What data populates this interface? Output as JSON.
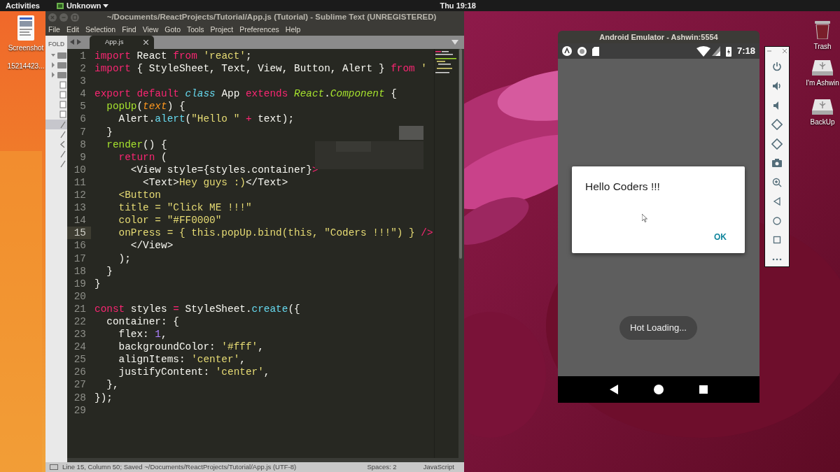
{
  "top_bar": {
    "activities": "Activities",
    "app_menu": "Unknown",
    "clock": "Thu 19:18"
  },
  "desktop_left": [
    {
      "kind": "document",
      "labels": [
        "Screenshot",
        "15214423..."
      ]
    }
  ],
  "desktop_right": [
    {
      "kind": "trash",
      "labels": [
        "Trash"
      ]
    },
    {
      "kind": "drive",
      "labels": [
        "I'm Ashwin"
      ]
    },
    {
      "kind": "drive",
      "labels": [
        "BackUp"
      ]
    }
  ],
  "editor": {
    "title": "~/Documents/ReactProjects/Tutorial/App.js (Tutorial) - Sublime Text (UNREGISTERED)",
    "menu": [
      "File",
      "Edit",
      "Selection",
      "Find",
      "View",
      "Goto",
      "Tools",
      "Project",
      "Preferences",
      "Help"
    ],
    "sidebar": {
      "header": "FOLD",
      "rows": [
        {
          "kind": "folder",
          "expanded": true,
          "selected": false
        },
        {
          "kind": "folder",
          "expanded": false,
          "selected": false
        },
        {
          "kind": "folder",
          "expanded": false,
          "selected": false
        },
        {
          "kind": "file",
          "selected": false
        },
        {
          "kind": "file",
          "selected": false
        },
        {
          "kind": "file",
          "selected": false
        },
        {
          "kind": "file",
          "selected": false
        },
        {
          "kind": "script",
          "selected": true
        },
        {
          "kind": "script",
          "selected": false
        },
        {
          "kind": "markup",
          "selected": false
        },
        {
          "kind": "script",
          "selected": false
        },
        {
          "kind": "script",
          "selected": false
        }
      ]
    },
    "tabs": [
      {
        "label": "App.js",
        "selected": true
      }
    ],
    "lines": [
      {
        "number": "1",
        "highlighted": false,
        "tokens": [
          {
            "kind": "k",
            "text": "import"
          },
          {
            "kind": "t",
            "text": " React"
          },
          {
            "kind": "k",
            "text": " from"
          },
          {
            "kind": "s",
            "text": " 'react'"
          },
          {
            "kind": "t",
            "text": ";"
          }
        ]
      },
      {
        "number": "2",
        "highlighted": false,
        "tokens": [
          {
            "kind": "k",
            "text": "import"
          },
          {
            "kind": "t",
            "text": " { StyleSheet, Text, View, Button, Alert }"
          },
          {
            "kind": "k",
            "text": " from"
          },
          {
            "kind": "s",
            "text": " '"
          }
        ]
      },
      {
        "number": "3",
        "highlighted": false
      },
      {
        "number": "4",
        "highlighted": false,
        "tokens": [
          {
            "kind": "k",
            "text": "export"
          },
          {
            "kind": "k",
            "text": " default"
          },
          {
            "kind": "i",
            "text": " class"
          },
          {
            "kind": "t",
            "text": " App"
          },
          {
            "kind": "k",
            "text": " extends"
          },
          {
            "kind": "c",
            "text": " React"
          },
          {
            "kind": "t",
            "text": "."
          },
          {
            "kind": "c",
            "text": "Component"
          },
          {
            "kind": "t",
            "text": " {"
          }
        ]
      },
      {
        "number": "5",
        "highlighted": false,
        "tokens": [
          {
            "kind": "g",
            "text": "  popUp"
          },
          {
            "kind": "t",
            "text": "("
          },
          {
            "kind": "p",
            "text": "text"
          },
          {
            "kind": "t",
            "text": ") {"
          }
        ]
      },
      {
        "number": "6",
        "highlighted": false,
        "tokens": [
          {
            "kind": "t",
            "text": "    Alert."
          },
          {
            "kind": "f",
            "text": "alert"
          },
          {
            "kind": "t",
            "text": "("
          },
          {
            "kind": "s",
            "text": "\"Hello \""
          },
          {
            "kind": "k",
            "text": " +"
          },
          {
            "kind": "t",
            "text": " text);"
          }
        ]
      },
      {
        "number": "7",
        "highlighted": false,
        "tokens": [
          {
            "kind": "t",
            "text": "  }"
          }
        ]
      },
      {
        "number": "8",
        "highlighted": false,
        "tokens": [
          {
            "kind": "g",
            "text": "  render"
          },
          {
            "kind": "t",
            "text": "() {"
          }
        ]
      },
      {
        "number": "9",
        "highlighted": false,
        "tokens": [
          {
            "kind": "k",
            "text": "    return"
          },
          {
            "kind": "t",
            "text": " ("
          }
        ]
      },
      {
        "number": "10",
        "highlighted": false,
        "tokens": [
          {
            "kind": "t",
            "text": "      <View style={styles.container}"
          },
          {
            "kind": "k",
            "text": ">"
          }
        ]
      },
      {
        "number": "11",
        "highlighted": false,
        "tokens": [
          {
            "kind": "t",
            "text": "        <Text>"
          },
          {
            "kind": "s",
            "text": "Hey guys :)"
          },
          {
            "kind": "t",
            "text": "</Text>"
          }
        ]
      },
      {
        "number": "12",
        "highlighted": false,
        "tokens": [
          {
            "kind": "s",
            "text": "    <Button"
          }
        ]
      },
      {
        "number": "13",
        "highlighted": false,
        "tokens": [
          {
            "kind": "s",
            "text": "    title = \"Click ME !!!\""
          }
        ]
      },
      {
        "number": "14",
        "highlighted": false,
        "tokens": [
          {
            "kind": "s",
            "text": "    color = \"#FF0000\""
          }
        ]
      },
      {
        "number": "15",
        "highlighted": true,
        "tokens": [
          {
            "kind": "s",
            "text": "    onPress = { this.popUp.bind(this, \"Coders !!!\") }"
          },
          {
            "kind": "k",
            "text": " />"
          }
        ]
      },
      {
        "number": "16",
        "highlighted": false,
        "tokens": [
          {
            "kind": "t",
            "text": "      </View>"
          }
        ]
      },
      {
        "number": "17",
        "highlighted": false,
        "tokens": [
          {
            "kind": "t",
            "text": "    );"
          }
        ]
      },
      {
        "number": "18",
        "highlighted": false,
        "tokens": [
          {
            "kind": "t",
            "text": "  }"
          }
        ]
      },
      {
        "number": "19",
        "highlighted": false,
        "tokens": [
          {
            "kind": "t",
            "text": "}"
          }
        ]
      },
      {
        "number": "20",
        "highlighted": false
      },
      {
        "number": "21",
        "highlighted": false,
        "tokens": [
          {
            "kind": "k",
            "text": "const"
          },
          {
            "kind": "t",
            "text": " styles"
          },
          {
            "kind": "k",
            "text": " ="
          },
          {
            "kind": "t",
            "text": " StyleSheet."
          },
          {
            "kind": "f",
            "text": "create"
          },
          {
            "kind": "t",
            "text": "({"
          }
        ]
      },
      {
        "number": "22",
        "highlighted": false,
        "tokens": [
          {
            "kind": "t",
            "text": "  container: {"
          }
        ]
      },
      {
        "number": "23",
        "highlighted": false,
        "tokens": [
          {
            "kind": "t",
            "text": "    flex:"
          },
          {
            "kind": "n",
            "text": " 1"
          },
          {
            "kind": "t",
            "text": ","
          }
        ]
      },
      {
        "number": "24",
        "highlighted": false,
        "tokens": [
          {
            "kind": "t",
            "text": "    backgroundColor:"
          },
          {
            "kind": "s",
            "text": " '#fff'"
          },
          {
            "kind": "t",
            "text": ","
          }
        ]
      },
      {
        "number": "25",
        "highlighted": false,
        "tokens": [
          {
            "kind": "t",
            "text": "    alignItems:"
          },
          {
            "kind": "s",
            "text": " 'center'"
          },
          {
            "kind": "t",
            "text": ","
          }
        ]
      },
      {
        "number": "26",
        "highlighted": false,
        "tokens": [
          {
            "kind": "t",
            "text": "    justifyContent:"
          },
          {
            "kind": "s",
            "text": " 'center'"
          },
          {
            "kind": "t",
            "text": ","
          }
        ]
      },
      {
        "number": "27",
        "highlighted": false,
        "tokens": [
          {
            "kind": "t",
            "text": "  },"
          }
        ]
      },
      {
        "number": "28",
        "highlighted": false,
        "tokens": [
          {
            "kind": "t",
            "text": "});"
          }
        ]
      },
      {
        "number": "29",
        "highlighted": false
      }
    ],
    "status_bar": {
      "position": "Line 15, Column 50; Saved ~/Documents/ReactProjects/Tutorial/App.js (UTF-8)",
      "indentation": "Spaces: 2",
      "syntax": "JavaScript"
    }
  },
  "emulator": {
    "title": "Android Emulator - Ashwin:5554",
    "time": "7:18",
    "dialog": {
      "message": "Hello Coders !!!",
      "button": "OK"
    },
    "toast": "Hot Loading..."
  }
}
